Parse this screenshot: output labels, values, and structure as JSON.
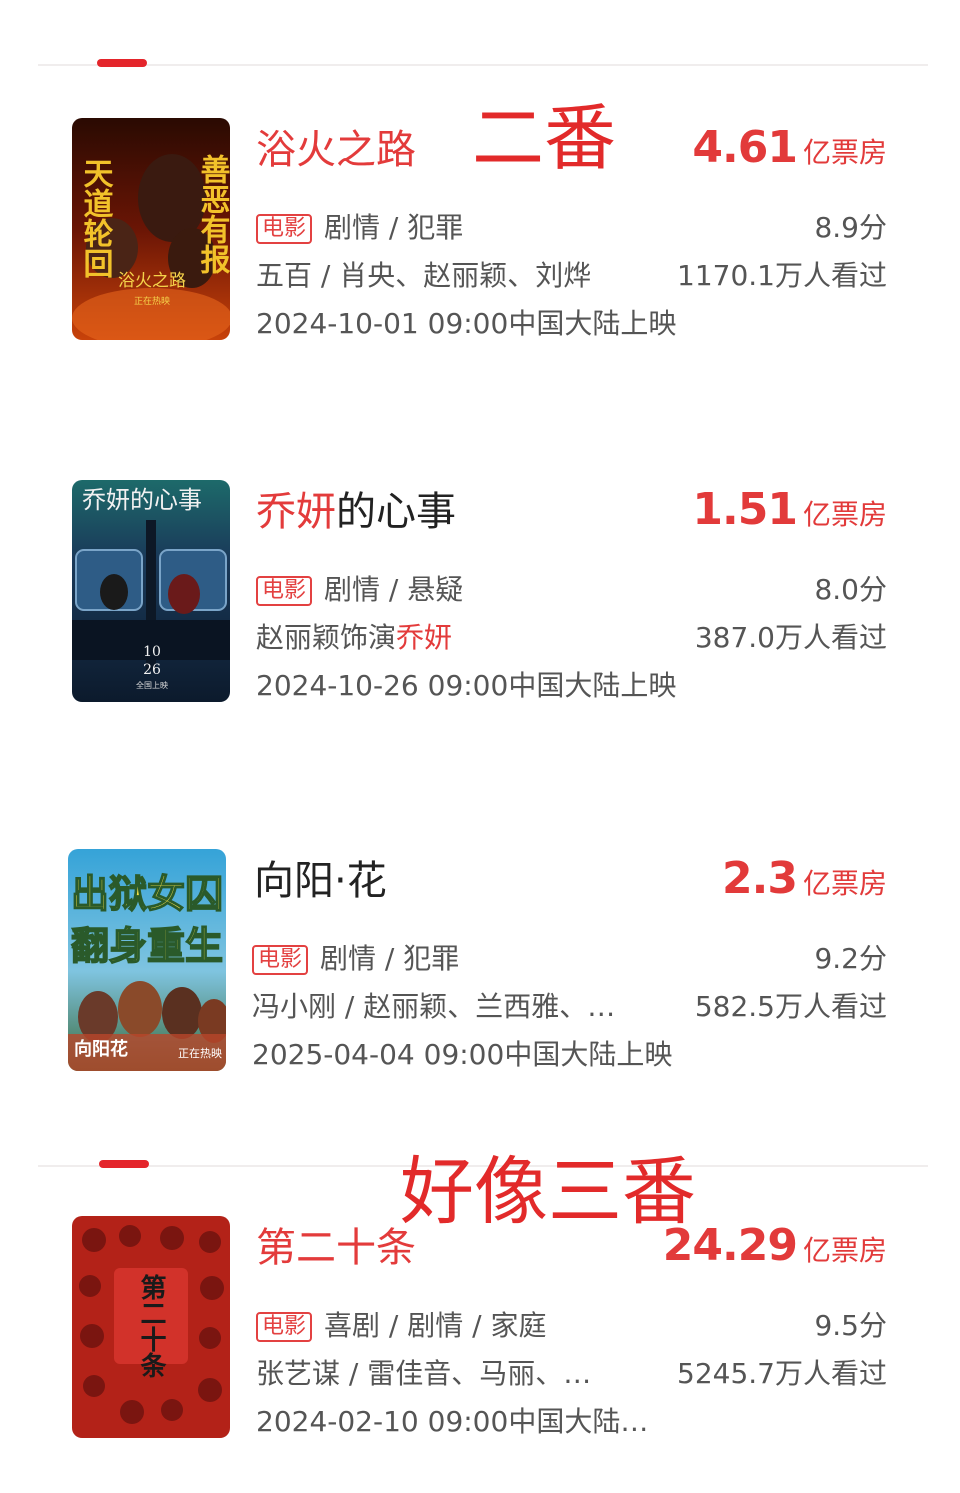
{
  "annotations": {
    "note_second_lead": "二番",
    "note_maybe_third_lead": "好像三番"
  },
  "colors": {
    "accent": "#e4252b",
    "annotation": "#e22a2a"
  },
  "movies": [
    {
      "title": "浴火之路",
      "boxoffice_value": "4.61",
      "boxoffice_unit": "亿票房",
      "tag": "电影",
      "genres": "剧情 / 犯罪",
      "score": "8.9分",
      "credits": "五百 / 肖央、赵丽颖、刘烨",
      "viewers": "1170.1万人看过",
      "release": "2024-10-01 09:00中国大陆上映",
      "poster": {
        "left_text": "天道轮回",
        "right_text": "善恶有报",
        "center_text": "浴火之路",
        "sub_text": "正在热映"
      }
    },
    {
      "title_highlight": "乔妍",
      "title_rest": "的心事",
      "boxoffice_value": "1.51",
      "boxoffice_unit": "亿票房",
      "tag": "电影",
      "genres": "剧情 / 悬疑",
      "score": "8.0分",
      "credits_prefix": "赵丽颖饰演",
      "credits_highlight": "乔妍",
      "viewers": "387.0万人看过",
      "release": "2024-10-26 09:00中国大陆上映",
      "poster": {
        "title_text": "乔妍的心事",
        "date_line1": "10",
        "date_line2": "26",
        "date_line3": "全国上映"
      }
    },
    {
      "title": "向阳·花",
      "boxoffice_value": "2.3",
      "boxoffice_unit": "亿票房",
      "tag": "电影",
      "genres": "剧情 / 犯罪",
      "score": "9.2分",
      "credits": "冯小刚 / 赵丽颖、兰西雅、…",
      "viewers": "582.5万人看过",
      "release": "2025-04-04 09:00中国大陆上映",
      "poster": {
        "line1": "出狱女囚",
        "line2": "翻身重生",
        "logo_text": "向阳花",
        "sub_text": "正在热映"
      }
    },
    {
      "title": "第二十条",
      "boxoffice_value": "24.29",
      "boxoffice_unit": "亿票房",
      "tag": "电影",
      "genres": "喜剧 / 剧情 / 家庭",
      "score": "9.5分",
      "credits": "张艺谋 / 雷佳音、马丽、…",
      "viewers": "5245.7万人看过",
      "release": "2024-02-10 09:00中国大陆…",
      "poster": {
        "center_text": "第二十条"
      }
    }
  ]
}
